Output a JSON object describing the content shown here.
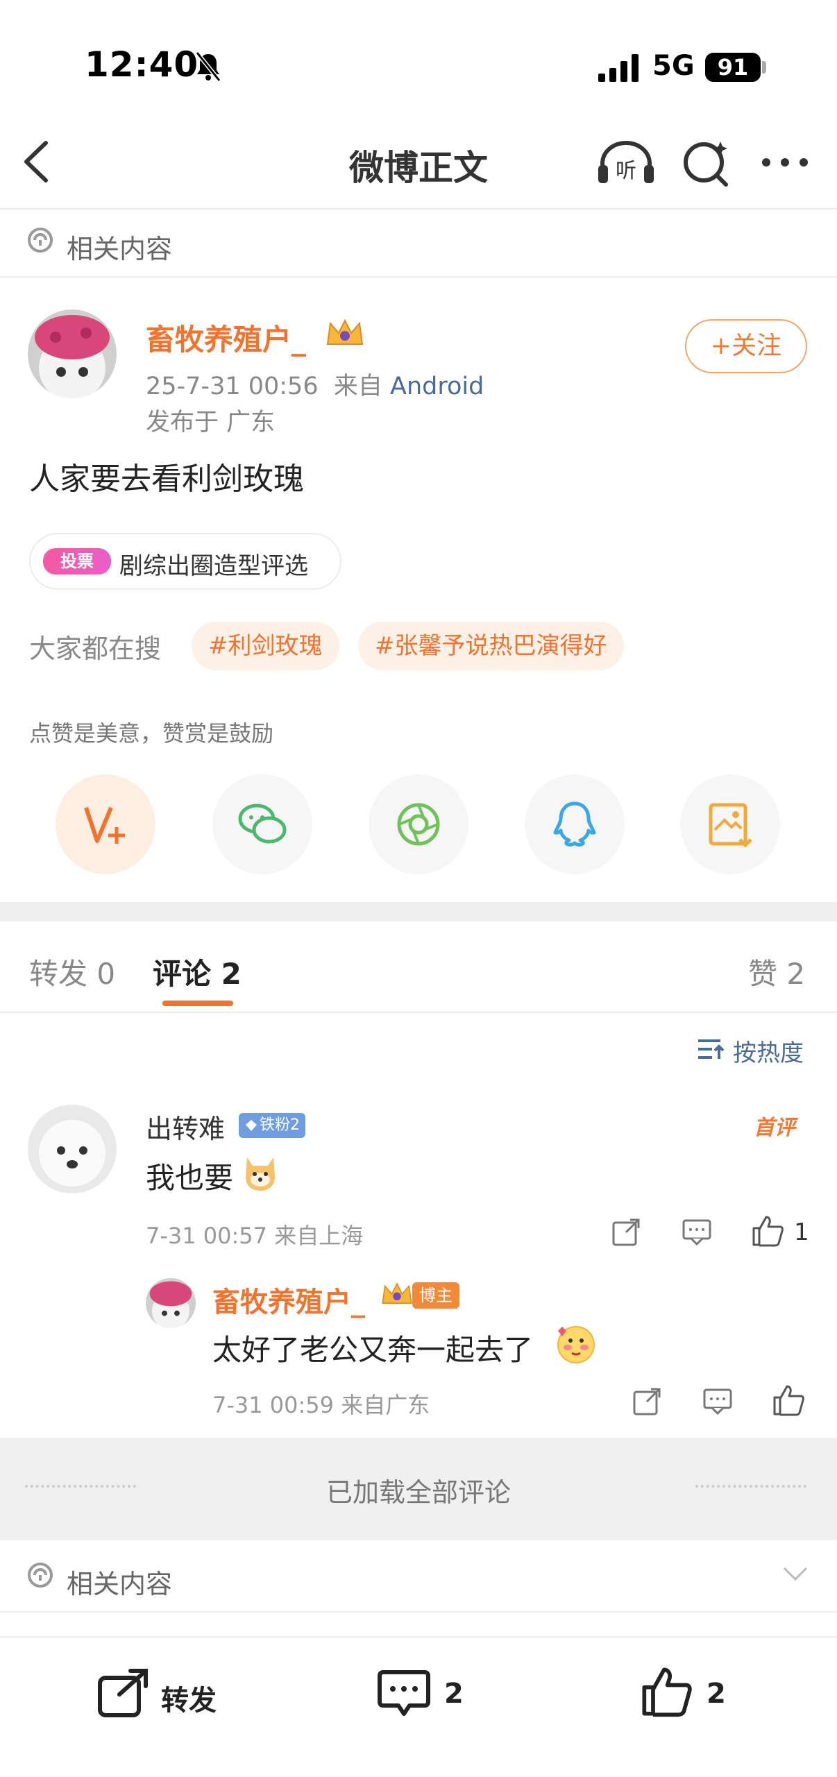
{
  "status": {
    "time": "12:40",
    "network": "5G",
    "battery": "91"
  },
  "nav": {
    "title": "微博正文"
  },
  "related_top": {
    "label": "相关内容"
  },
  "post": {
    "author": "畜牧养殖户_",
    "time": "25-7-31 00:56",
    "from_prefix": "来自",
    "source": "Android",
    "location": "发布于 广东",
    "follow_label": "+关注",
    "text": "人家要去看利剑玫瑰",
    "vote_badge": "投票",
    "vote_title": "剧综出圈造型评选",
    "search_label": "大家都在搜",
    "tags": [
      "#利剑玫瑰",
      "#张馨予说热巴演得好"
    ],
    "tip": "点赞是美意，赞赏是鼓励"
  },
  "share_icons": [
    "v-plus-icon",
    "wechat-icon",
    "moments-icon",
    "qq-icon",
    "save-image-icon"
  ],
  "tabs": {
    "repost": "转发 0",
    "comments": "评论 2",
    "likes": "赞 2"
  },
  "sort_label": "按热度",
  "comments": [
    {
      "name": "出转难",
      "badge": "铁粉2",
      "first_label": "首评",
      "text": "我也要",
      "meta": "7-31 00:57 来自上海",
      "likes": "1"
    }
  ],
  "reply": {
    "name": "畜牧养殖户_",
    "badge": "博主",
    "text": "太好了老公又奔一起去了",
    "meta": "7-31 00:59 来自广东"
  },
  "loaded_text": "已加载全部评论",
  "related_bottom": {
    "label": "相关内容"
  },
  "bottom_bar": {
    "repost": "转发",
    "comments": "2",
    "likes": "2"
  },
  "colors": {
    "accent": "#f0732f",
    "link": "#4a6b9a",
    "fan_badge": "#6f9ddf"
  }
}
